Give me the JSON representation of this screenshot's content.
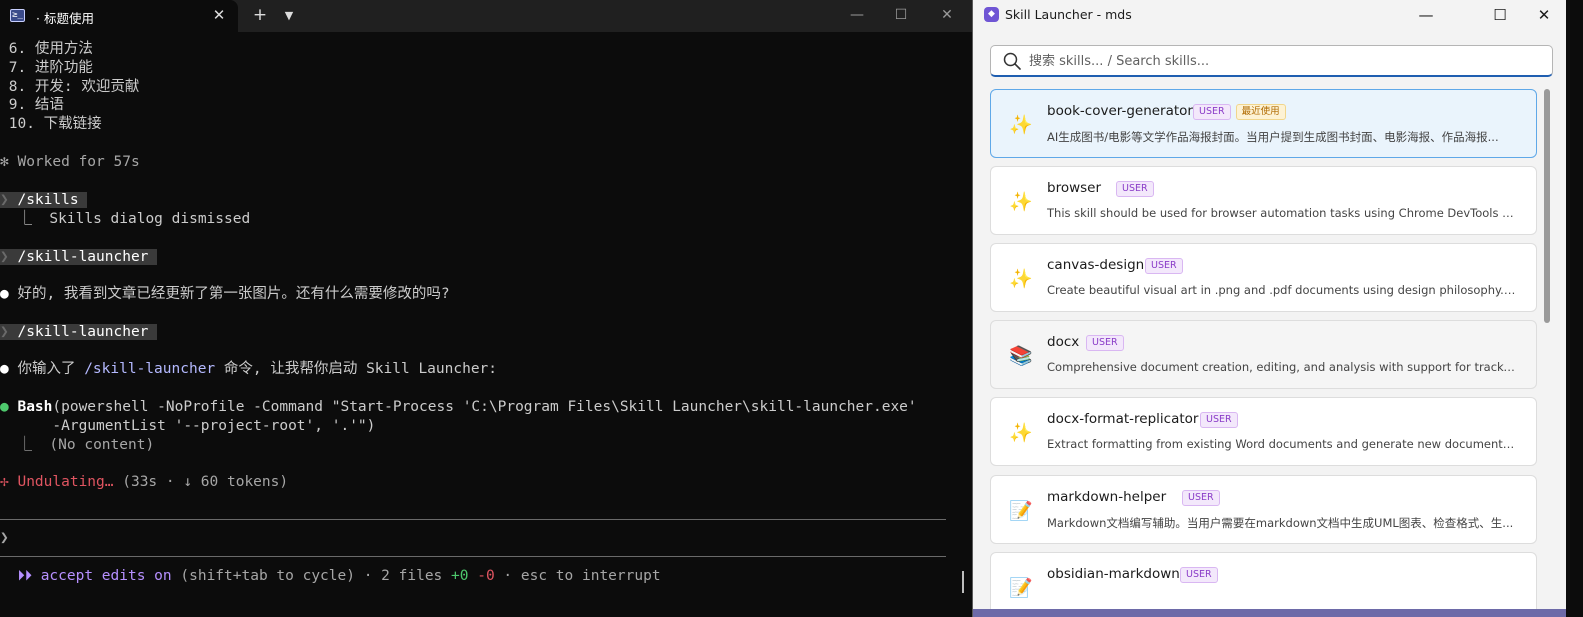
{
  "terminal": {
    "tab_icon_glyph": "≥_",
    "tab_title": "· 标题使用",
    "lines": {
      "l1": " 6. 使用方法",
      "l2": " 7. 进阶功能",
      "l3": " 8. 开发: 欢迎贡献",
      "l4": " 9. 结语",
      "l5": " 10. 下载链接",
      "worked_glyph": "✻",
      "worked": " Worked for 57s",
      "cmd_chevron": "❯",
      "cmd1": " /skills ",
      "cmd1_result": "  ⎿  Skills dialog dismissed",
      "cmd2": " /skill-launcher ",
      "bullet": "●",
      "reply1": " 好的, 我看到文章已经更新了第一张图片。还有什么需要修改的吗?",
      "cmd3": " /skill-launcher ",
      "reply2_pre": " 你输入了 ",
      "reply2_cmd": "/skill-launcher",
      "reply2_post": " 命令, 让我帮你启动 Skill Launcher:",
      "bash_name": " Bash",
      "bash_args1": "(powershell -NoProfile -Command \"Start-Process 'C:\\Program Files\\Skill Launcher\\skill-launcher.exe'",
      "bash_args2": "      -ArgumentList '--project-root', '.'\")",
      "bash_result": "  ⎿  (No content)",
      "status_glyph": "✢",
      "status_label": " Undulating…",
      "status_meta": " (33s · ↓ 60 tokens)",
      "prompt_chevron": "❯",
      "mode_glyph": "  ⏵⏵",
      "mode_label": " accept edits on",
      "mode_hint": " (shift+tab to cycle) · 2 files ",
      "files_added": "+0",
      "files_removed": " -0",
      "mode_tail": " · esc to interrupt"
    }
  },
  "launcher": {
    "app_icon_glyph": "◆",
    "title": "Skill Launcher - mds",
    "search_placeholder": "搜索 skills... / Search skills...",
    "skills": [
      {
        "name": "book-cover-generator",
        "badge": "USER",
        "recent": "最近使用",
        "icon": "sparkle-icon",
        "glyph": "✨",
        "desc": "AI生成图书/电影等文学作品海报封面。当用户提到生成图书封面、电影海报、作品海报..."
      },
      {
        "name": "browser",
        "badge": "USER",
        "icon": "sparkle-icon",
        "glyph": "✨",
        "desc": "This skill should be used for browser automation tasks using Chrome DevTools Protocol ..."
      },
      {
        "name": "canvas-design",
        "badge": "USER",
        "icon": "sparkle-icon",
        "glyph": "✨",
        "desc": "Create beautiful visual art in .png and .pdf documents using design philosophy. You sho..."
      },
      {
        "name": "docx",
        "badge": "USER",
        "icon": "books-icon",
        "glyph": "📚",
        "desc": "Comprehensive document creation, editing, and analysis with support for tracked chang..."
      },
      {
        "name": "docx-format-replicator",
        "badge": "USER",
        "icon": "sparkle-icon",
        "glyph": "✨",
        "desc": "Extract formatting from existing Word documents and generate new documents with the..."
      },
      {
        "name": "markdown-helper",
        "badge": "USER",
        "icon": "memo-icon",
        "glyph": "📝",
        "desc": "Markdown文档编写辅助。当用户需要在markdown文档中生成UML图表、检查格式、生..."
      },
      {
        "name": "obsidian-markdown",
        "badge": "USER",
        "icon": "memo-icon",
        "glyph": "📝",
        "desc": ""
      }
    ]
  }
}
